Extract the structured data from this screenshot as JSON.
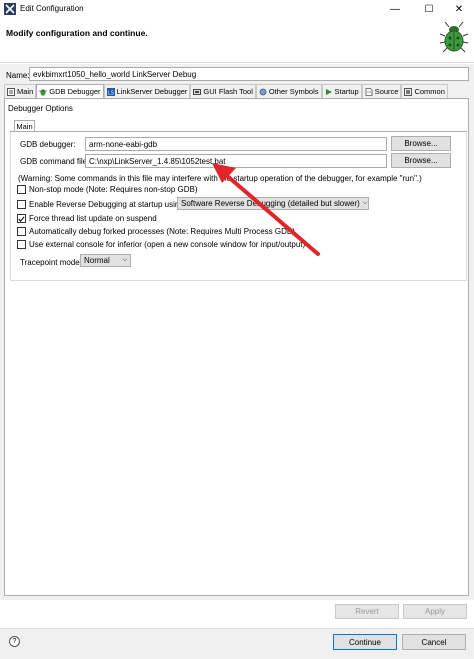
{
  "window": {
    "title": "Edit Configuration",
    "minimize": "—",
    "maximize": "☐",
    "close": "✕"
  },
  "header": {
    "title": "Modify configuration and continue."
  },
  "name": {
    "label": "Name:",
    "value": "evkbimxrt1050_hello_world LinkServer Debug"
  },
  "tabs": [
    {
      "label": "Main",
      "icon": "main-tab-icon"
    },
    {
      "label": "GDB Debugger",
      "icon": "debugger-tab-icon"
    },
    {
      "label": "LinkServer Debugger",
      "icon": "linkserver-tab-icon"
    },
    {
      "label": "GUI Flash Tool",
      "icon": "flash-tool-icon"
    },
    {
      "label": "Other Symbols",
      "icon": "symbols-icon"
    },
    {
      "label": "Startup",
      "icon": "startup-icon"
    },
    {
      "label": "Source",
      "icon": "source-icon"
    },
    {
      "label": "Common",
      "icon": "common-icon"
    }
  ],
  "panel": {
    "section_title": "Debugger Options",
    "subtab": "Main",
    "gdb_debugger_label": "GDB debugger:",
    "gdb_debugger_value": "arm-none-eabi-gdb",
    "gdb_command_label": "GDB command file:",
    "gdb_command_value": "C:\\nxp\\LinkServer_1.4.85\\1052test.bat",
    "browse_label": "Browse...",
    "warning": "(Warning: Some commands in this file may interfere with the startup operation of the debugger, for example \"run\".)",
    "non_stop": {
      "label": "Non-stop mode (Note: Requires non-stop GDB)",
      "checked": false
    },
    "reverse_debug": {
      "label": "Enable Reverse Debugging at startup using:",
      "checked": false
    },
    "reverse_select": "Software Reverse Debugging (detailed but slower)",
    "force_thread": {
      "label": "Force thread list update on suspend",
      "checked": true
    },
    "auto_forked": {
      "label": "Automatically debug forked processes (Note: Requires Multi Process GDB)",
      "checked": false
    },
    "external_console": {
      "label": "Use external console for inferior (open a new console window for input/output)",
      "checked": false
    },
    "tracepoint_label": "Tracepoint mode:",
    "tracepoint_value": "Normal"
  },
  "buttons": {
    "revert": "Revert",
    "apply": "Apply",
    "continue": "Continue",
    "cancel": "Cancel"
  },
  "colors": {
    "annotation_arrow": "#e0262b",
    "accent_border": "#0078d7"
  }
}
